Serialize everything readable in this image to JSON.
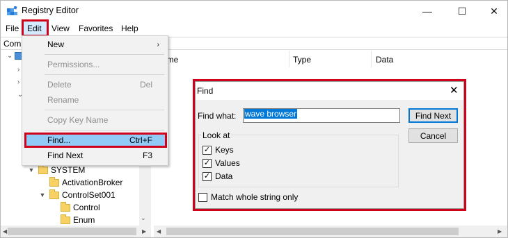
{
  "window": {
    "title": "Registry Editor",
    "min_glyph": "—",
    "max_glyph": "☐",
    "close_glyph": "✕"
  },
  "menubar": {
    "file": "File",
    "edit": "Edit",
    "view": "View",
    "favorites": "Favorites",
    "help": "Help"
  },
  "address": {
    "text": "Com"
  },
  "tree": {
    "items": [
      {
        "label": "SYSTEM",
        "expanded": true
      },
      {
        "label": "ActivationBroker",
        "expanded": false
      },
      {
        "label": "ControlSet001",
        "expanded": true
      },
      {
        "label": "Control",
        "expanded": false
      },
      {
        "label": "Enum",
        "expanded": false
      }
    ]
  },
  "columns": {
    "name_partial": "ame",
    "type": "Type",
    "data": "Data"
  },
  "edit_menu": {
    "new": "New",
    "permissions": "Permissions...",
    "delete": "Delete",
    "delete_shortcut": "Del",
    "rename": "Rename",
    "copy_key_name": "Copy Key Name",
    "find": "Find...",
    "find_shortcut": "Ctrl+F",
    "find_next": "Find Next",
    "find_next_shortcut": "F3"
  },
  "find_dialog": {
    "title": "Find",
    "find_what_label": "Find what:",
    "find_what_value": "wave browser",
    "find_next_button": "Find Next",
    "cancel_button": "Cancel",
    "look_at_label": "Look at",
    "keys_label": "Keys",
    "keys_checked": true,
    "values_label": "Values",
    "values_checked": true,
    "data_label": "Data",
    "data_checked": true,
    "match_whole_label": "Match whole string only",
    "match_whole_checked": false
  },
  "colors": {
    "highlight_outline": "#d0021b",
    "selection_blue": "#0078d7",
    "menu_hover": "#91c9f7",
    "folder_yellow": "#f7d164"
  }
}
